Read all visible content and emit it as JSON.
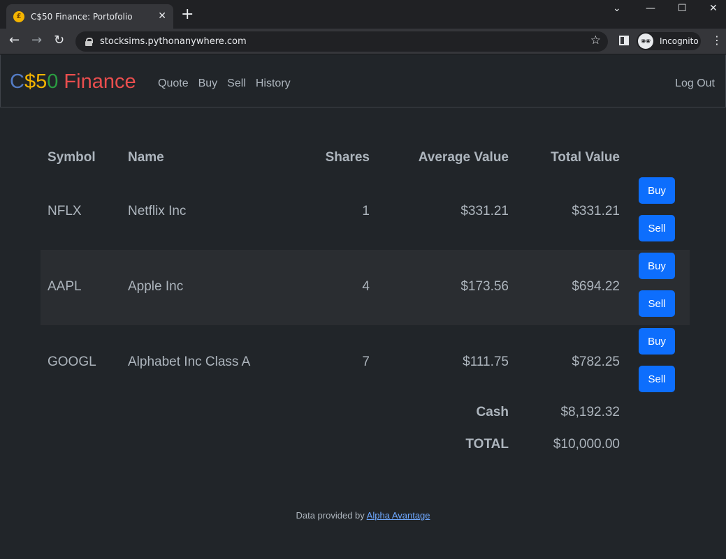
{
  "browser": {
    "tab_title": "C$50 Finance: Portofolio",
    "url": "stocksims.pythonanywhere.com",
    "incognito_label": "Incognito"
  },
  "navbar": {
    "brand": [
      "C",
      "$",
      "5",
      "0",
      " Finance"
    ],
    "links": [
      "Quote",
      "Buy",
      "Sell",
      "History"
    ],
    "logout": "Log Out"
  },
  "table": {
    "headers": [
      "Symbol",
      "Name",
      "Shares",
      "Average Value",
      "Total Value"
    ],
    "rows": [
      {
        "symbol": "NFLX",
        "name": "Netflix Inc",
        "shares": "1",
        "avg": "$331.21",
        "total": "$331.21"
      },
      {
        "symbol": "AAPL",
        "name": "Apple Inc",
        "shares": "4",
        "avg": "$173.56",
        "total": "$694.22"
      },
      {
        "symbol": "GOOGL",
        "name": "Alphabet Inc Class A",
        "shares": "7",
        "avg": "$111.75",
        "total": "$782.25"
      }
    ],
    "buy_label": "Buy",
    "sell_label": "Sell",
    "cash_label": "Cash",
    "cash_value": "$8,192.32",
    "total_label": "TOTAL",
    "total_value": "$10,000.00"
  },
  "footer": {
    "text": "Data provided by ",
    "link": "Alpha Avantage"
  },
  "colors": {
    "page_bg": "#212529",
    "primary_button": "#0d6efd",
    "brand_c": "#537bc4",
    "brand_dollar": "#f4b400",
    "brand_5": "#f4b400",
    "brand_0": "#2a9d41",
    "brand_finance": "#e94e4e"
  }
}
